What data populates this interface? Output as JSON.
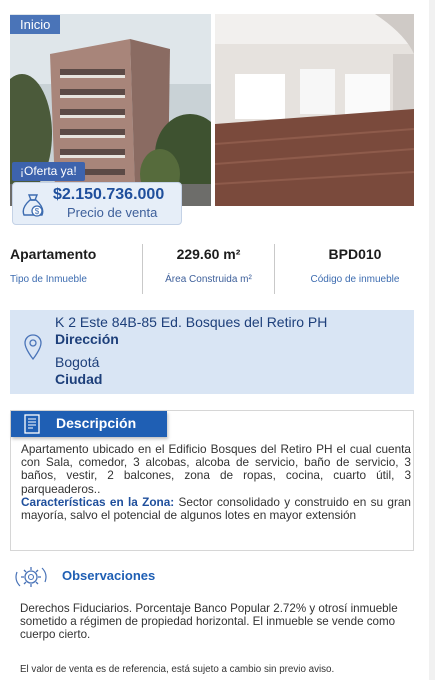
{
  "breadcrumb": {
    "label": "Inicio"
  },
  "gallery": {
    "offer_tag": "¡Oferta ya!",
    "price_value": "$2.150.736.000",
    "price_label": "Precio de venta"
  },
  "stats": [
    {
      "value": "Apartamento",
      "label": "Tipo de Inmueble"
    },
    {
      "value": "229.60 m²",
      "label": "Área Construida m²"
    },
    {
      "value": "BPD010",
      "label": "Código de inmueble"
    }
  ],
  "location": {
    "address": "K 2 Este 84B-85 Ed. Bosques del Retiro PH",
    "address_label": "Dirección",
    "city": "Bogotá",
    "city_label": "Ciudad"
  },
  "description": {
    "title": "Descripción",
    "text": "Apartamento ubicado en el Edificio Bosques del Retiro PH el cual cuenta con Sala, comedor, 3 alcobas, alcoba de servicio, baño de servicio, 3 baños, vestir, 2 balcones, zona de ropas, cocina, cuarto útil, 3 parqueaderos..",
    "zone_label": "Características en la Zona:",
    "zone_text": " Sector consolidado y construido en su gran mayoría, salvo el potencial de algunos lotes en mayor extensión"
  },
  "observations": {
    "title": "Observaciones",
    "text": "Derechos Fiduciarios. Porcentaje Banco Popular 2.72% y otrosí inmueble sometido a régimen de propiedad horizontal. El inmueble se vende como cuerpo cierto."
  },
  "footnote": "El valor de venta es de referencia, está sujeto a cambio sin previo aviso.",
  "icons": {
    "price": "money-bag-icon",
    "location": "map-pin-icon",
    "description": "document-icon",
    "observations": "gear-cycle-icon"
  },
  "colors": {
    "brand_blue": "#1f5fb4",
    "address_bg": "#d9e5f4",
    "price_bg": "#e6eef8"
  }
}
